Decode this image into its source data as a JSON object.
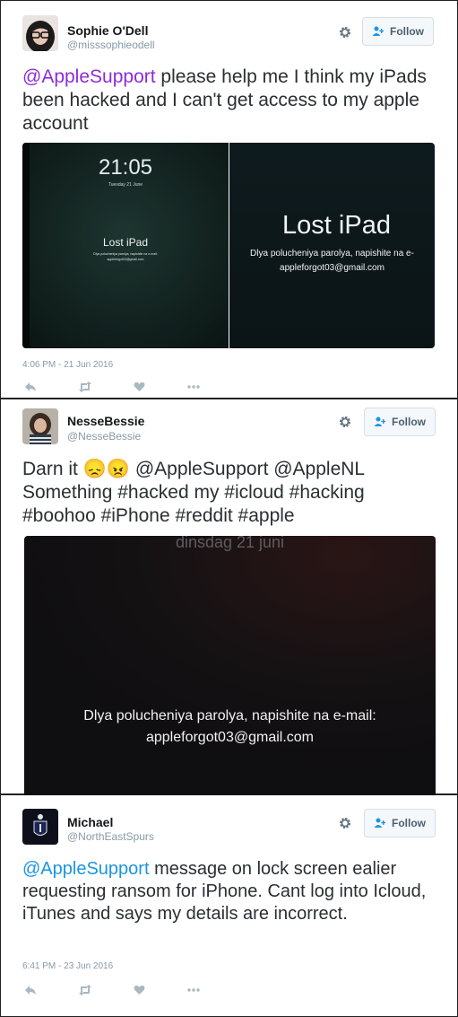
{
  "tweets": [
    {
      "name": "Sophie O'Dell",
      "handle": "@misssophieodell",
      "follow_label": "Follow",
      "text_mention": "@AppleSupport",
      "text_rest": " please help me I think my iPads been hacked and I can't get access to my apple account",
      "media_left": {
        "time": "21:05",
        "date": "Tuesday 21 June",
        "title": "Lost iPad",
        "line1": "Dlya polucheniya parolya, napishite na e-mail:",
        "line2": "appleforgot03@gmail.com"
      },
      "media_right": {
        "title": "Lost iPad",
        "line1": "Dlya polucheniya parolya, napishite na e-",
        "line2": "appleforgot03@gmail.com"
      },
      "timestamp": "4:06 PM - 21 Jun 2016"
    },
    {
      "name": "NesseBessie",
      "handle": "@NesseBessie",
      "follow_label": "Follow",
      "text_line1_pre": "Darn it ",
      "text_line1_emoji": "😞😠",
      "text_line1_post": " @AppleSupport @AppleNL",
      "text_line2": "Something #hacked my #icloud #hacking",
      "text_line3": "#boohoo #iPhone #reddit #apple",
      "media": {
        "date": "dinsdag 21 juni",
        "line1": "Dlya polucheniya parolya, napishite na e-mail:",
        "line2": "appleforgot03@gmail.com"
      }
    },
    {
      "name": "Michael",
      "handle": "@NorthEastSpurs",
      "follow_label": "Follow",
      "text_mention": "@AppleSupport",
      "text_rest": " message on lock screen ealier requesting ransom for iPhone. Cant log into Icloud, iTunes and says my details are incorrect.",
      "timestamp": "6:41 PM - 23 Jun 2016"
    }
  ],
  "colors": {
    "mention_purple": "#8e2bd8",
    "mention_blue": "#1b95e0",
    "meta_gray": "#8899a6"
  }
}
